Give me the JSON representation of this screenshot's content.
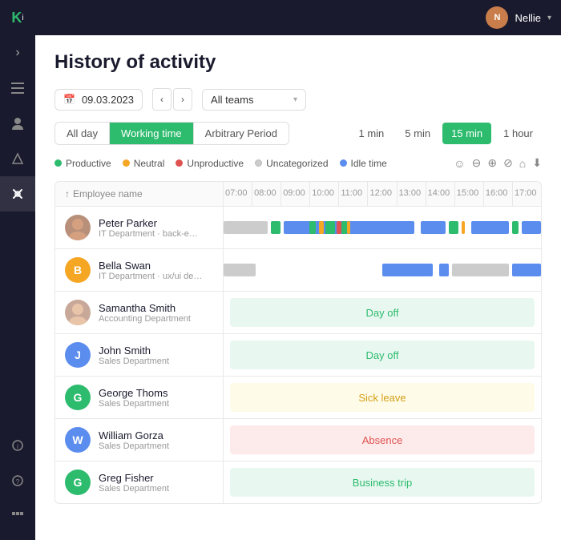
{
  "app": {
    "logo": "Ki",
    "user": "Nellie"
  },
  "sidebar": {
    "items": [
      {
        "name": "menu-icon",
        "icon": "☰",
        "active": false
      },
      {
        "name": "person-icon",
        "icon": "👤",
        "active": false
      },
      {
        "name": "share-icon",
        "icon": "⬡",
        "active": false
      },
      {
        "name": "tools-icon",
        "icon": "🔧",
        "active": true
      },
      {
        "name": "info-icon",
        "icon": "ℹ",
        "active": false
      },
      {
        "name": "help-icon",
        "icon": "?",
        "active": false
      },
      {
        "name": "expand-icon",
        "icon": "»",
        "active": false
      }
    ]
  },
  "page": {
    "title": "History of activity"
  },
  "filters": {
    "date": "09.03.2023",
    "team": "All teams",
    "team_options": [
      "All teams",
      "IT Department",
      "Sales Department",
      "Accounting Department"
    ]
  },
  "period_tabs": [
    {
      "label": "All day",
      "active": false
    },
    {
      "label": "Working time",
      "active": true
    },
    {
      "label": "Arbitrary Period",
      "active": false
    }
  ],
  "interval_tabs": [
    {
      "label": "1 min",
      "active": false
    },
    {
      "label": "5 min",
      "active": false
    },
    {
      "label": "15 min",
      "active": true
    },
    {
      "label": "1 hour",
      "active": false
    }
  ],
  "legend": {
    "items": [
      {
        "label": "Productive",
        "color": "#2dbb6e"
      },
      {
        "label": "Neutral",
        "color": "#f5a623"
      },
      {
        "label": "Unproductive",
        "color": "#e05252"
      },
      {
        "label": "Uncategorized",
        "color": "#ccc"
      },
      {
        "label": "Idle time",
        "color": "#5b8dee"
      }
    ]
  },
  "timeline": {
    "header": "Employee name",
    "sort_icon": "↑",
    "hours": [
      "07:00",
      "08:00",
      "09:00",
      "10:00",
      "11:00",
      "12:00",
      "13:00",
      "14:00",
      "15:00",
      "16:00",
      "17:00"
    ]
  },
  "employees": [
    {
      "name": "Peter Parker",
      "dept": "IT Department · back-end de...",
      "avatar_text": "",
      "avatar_img": true,
      "avatar_color": "#8a6a5a",
      "type": "gantt"
    },
    {
      "name": "Bella Swan",
      "dept": "IT Department · ux/ui design...",
      "avatar_text": "B",
      "avatar_color": "#f5a623",
      "type": "gantt2"
    },
    {
      "name": "Samantha Smith",
      "dept": "Accounting Department",
      "avatar_text": "",
      "avatar_img": true,
      "avatar_color": "#8a6a5a",
      "type": "dayoff",
      "status_label": "Day off",
      "status_class": "status-dayoff"
    },
    {
      "name": "John Smith",
      "dept": "Sales Department",
      "avatar_text": "J",
      "avatar_color": "#5b8dee",
      "type": "dayoff",
      "status_label": "Day off",
      "status_class": "status-dayoff"
    },
    {
      "name": "George Thoms",
      "dept": "Sales Department",
      "avatar_text": "G",
      "avatar_color": "#2dbb6e",
      "type": "dayoff",
      "status_label": "Sick leave",
      "status_class": "status-sickleave"
    },
    {
      "name": "William Gorza",
      "dept": "Sales Department",
      "avatar_text": "W",
      "avatar_color": "#5b8dee",
      "type": "dayoff",
      "status_label": "Absence",
      "status_class": "status-absence"
    },
    {
      "name": "Greg Fisher",
      "dept": "Sales Department",
      "avatar_text": "G",
      "avatar_color": "#2dbb6e",
      "type": "dayoff",
      "status_label": "Business trip",
      "status_class": "status-business"
    }
  ]
}
